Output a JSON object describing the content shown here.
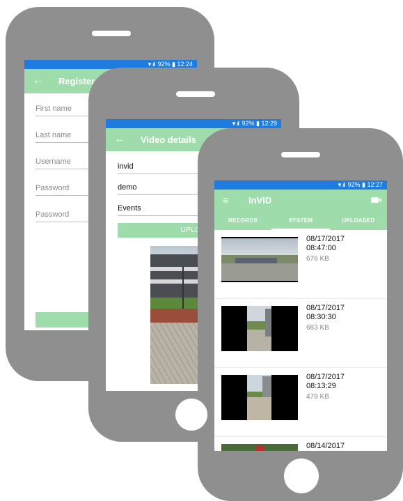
{
  "register_screen": {
    "status": {
      "battery": "92%",
      "time": "12:24"
    },
    "title": "Register",
    "fields": [
      "First name",
      "Last name",
      "Username",
      "Password",
      "Password"
    ]
  },
  "video_details_screen": {
    "status": {
      "battery": "92%",
      "time": "12:29"
    },
    "title": "Video details",
    "fields": [
      "invid",
      "demo",
      "Events"
    ],
    "upload_label": "UPLOAD"
  },
  "invid_screen": {
    "status": {
      "battery": "92%",
      "time": "12:27"
    },
    "app_title": "InVID",
    "tabs": [
      "RECORDS",
      "SYSTEM",
      "UPLOADED"
    ],
    "active_tab": "SYSTEM",
    "items": [
      {
        "date": "08/17/2017",
        "time": "08:47:00",
        "size": "676 KB"
      },
      {
        "date": "08/17/2017",
        "time": "08:30:30",
        "size": "683 KB"
      },
      {
        "date": "08/17/2017",
        "time": "08:13:29",
        "size": "479 KB"
      },
      {
        "date": "08/14/2017",
        "time": "",
        "size": ""
      }
    ]
  },
  "colors": {
    "status_bar": "#1e7be0",
    "accent_green": "#9fdcab",
    "phone_body": "#8f8f8f"
  },
  "icons": [
    "back-arrow-icon",
    "wifi-icon",
    "signal-icon",
    "battery-icon",
    "menu-icon",
    "camera-icon"
  ]
}
